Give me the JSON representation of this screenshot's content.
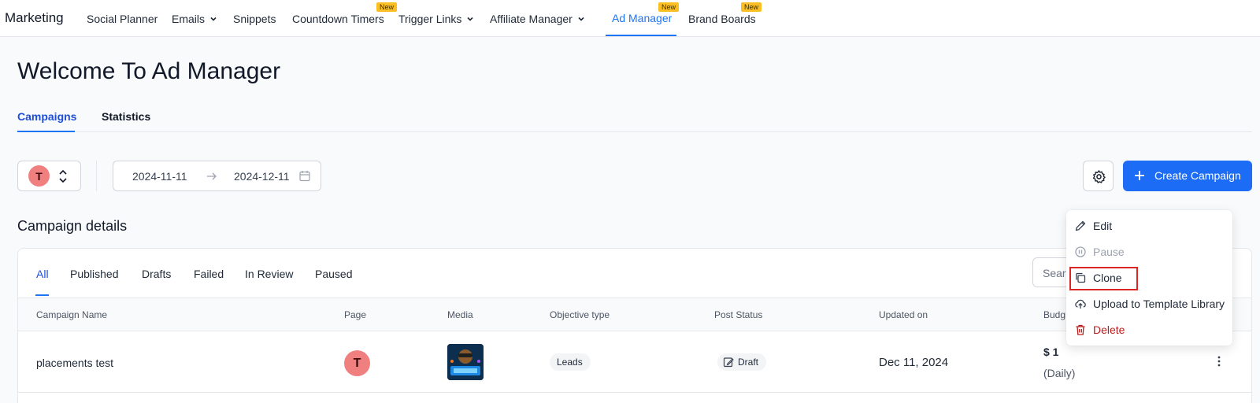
{
  "nav": {
    "brand": "Marketing",
    "items": [
      {
        "label": "Social Planner"
      },
      {
        "label": "Emails"
      },
      {
        "label": "Snippets"
      },
      {
        "label": "Countdown Timers",
        "badge": "New"
      },
      {
        "label": "Trigger Links"
      },
      {
        "label": "Affiliate Manager"
      },
      {
        "label": "Ad Manager",
        "badge": "New",
        "active": true
      },
      {
        "label": "Brand Boards",
        "badge": "New"
      }
    ]
  },
  "page": {
    "title": "Welcome To Ad Manager",
    "tabs": [
      {
        "label": "Campaigns",
        "active": true
      },
      {
        "label": "Statistics"
      }
    ]
  },
  "controls": {
    "account_initial": "T",
    "date_start": "2024-11-11",
    "date_end": "2024-12-11",
    "create_label": "Create Campaign"
  },
  "campaigns": {
    "section_title": "Campaign details",
    "filters": [
      "All",
      "Published",
      "Drafts",
      "Failed",
      "In Review",
      "Paused"
    ],
    "active_filter": "All",
    "search_placeholder": "Sear",
    "columns": [
      "Campaign Name",
      "Page",
      "Media",
      "Objective type",
      "Post Status",
      "Updated on",
      "Budg"
    ],
    "rows": [
      {
        "name": "placements test",
        "page_initial": "T",
        "objective": "Leads",
        "status": "Draft",
        "updated": "Dec 11, 2024",
        "budget": "$ 1",
        "budget_period": "(Daily)"
      }
    ]
  },
  "row_menu": {
    "items": [
      {
        "label": "Edit",
        "icon": "pencil-icon"
      },
      {
        "label": "Pause",
        "icon": "pause-icon",
        "disabled": true
      },
      {
        "label": "Clone",
        "icon": "copy-icon",
        "highlighted": true
      },
      {
        "label": "Upload to Template Library",
        "icon": "cloud-upload-icon"
      },
      {
        "label": "Delete",
        "icon": "trash-icon",
        "danger": true
      }
    ]
  },
  "colors": {
    "accent": "#1d74f5",
    "primary_button": "#1d6cf5",
    "badge": "#fbbf24",
    "avatar": "#f08080",
    "danger": "#b91c1c",
    "highlight_border": "#dc2626"
  }
}
